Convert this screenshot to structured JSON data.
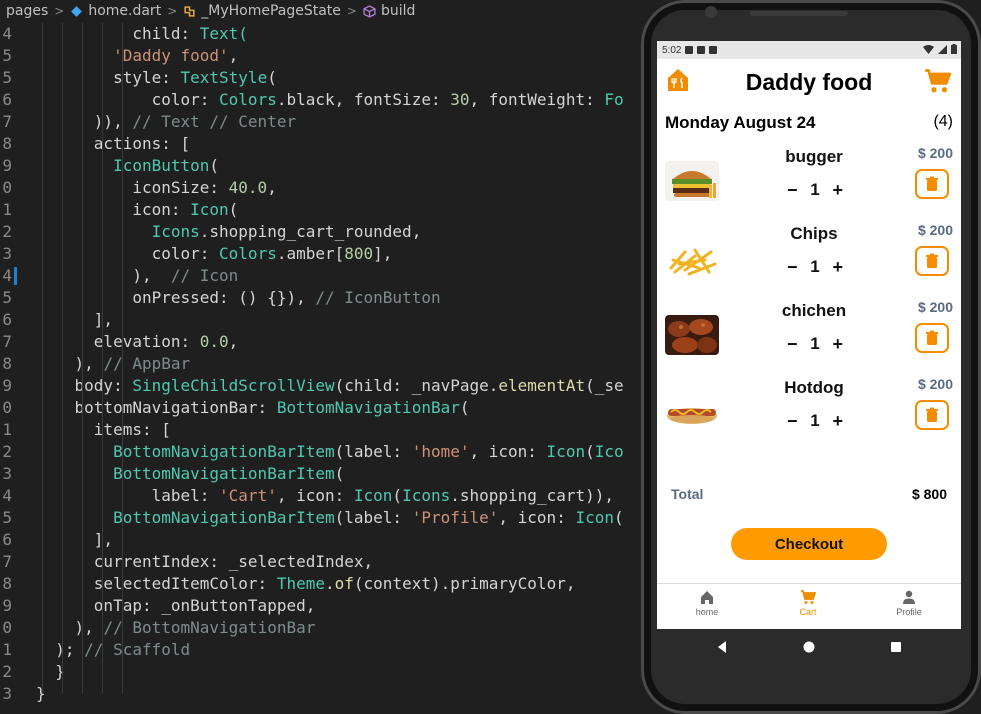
{
  "editor": {
    "breadcrumb": [
      "pages",
      "home.dart",
      "_MyHomePageState",
      "build"
    ],
    "lines": [
      {
        "n": "4",
        "parts": [
          {
            "t": "          child: ",
            "c": "t-prop"
          },
          {
            "t": "Text(",
            "c": "t-cls"
          }
        ]
      },
      {
        "n": "5",
        "parts": [
          {
            "t": "        ",
            "c": ""
          },
          {
            "t": "'Daddy food'",
            "c": "t-str"
          },
          {
            "t": ",",
            "c": ""
          }
        ]
      },
      {
        "n": "5",
        "parts": [
          {
            "t": "        style: ",
            "c": ""
          },
          {
            "t": "TextStyle",
            "c": "t-cls"
          },
          {
            "t": "(",
            "c": ""
          }
        ]
      },
      {
        "n": "6",
        "parts": [
          {
            "t": "            color: ",
            "c": ""
          },
          {
            "t": "Colors",
            "c": "t-cls"
          },
          {
            "t": ".black, fontSize: ",
            "c": ""
          },
          {
            "t": "30",
            "c": "t-num"
          },
          {
            "t": ", fontWeight: ",
            "c": ""
          },
          {
            "t": "Fo",
            "c": "t-cls"
          }
        ]
      },
      {
        "n": "7",
        "parts": [
          {
            "t": "      )), ",
            "c": ""
          },
          {
            "t": "// Text // Center",
            "c": "t-com"
          }
        ]
      },
      {
        "n": "8",
        "parts": [
          {
            "t": "      actions: [",
            "c": ""
          }
        ]
      },
      {
        "n": "9",
        "parts": [
          {
            "t": "        ",
            "c": ""
          },
          {
            "t": "IconButton",
            "c": "t-cls"
          },
          {
            "t": "(",
            "c": ""
          }
        ]
      },
      {
        "n": "0",
        "parts": [
          {
            "t": "          iconSize: ",
            "c": ""
          },
          {
            "t": "40.0",
            "c": "t-num"
          },
          {
            "t": ",",
            "c": ""
          }
        ]
      },
      {
        "n": "1",
        "parts": [
          {
            "t": "          icon: ",
            "c": ""
          },
          {
            "t": "Icon",
            "c": "t-cls"
          },
          {
            "t": "(",
            "c": ""
          }
        ]
      },
      {
        "n": "2",
        "parts": [
          {
            "t": "            ",
            "c": ""
          },
          {
            "t": "Icons",
            "c": "t-cls"
          },
          {
            "t": ".shopping_cart_rounded,",
            "c": ""
          }
        ]
      },
      {
        "n": "3",
        "parts": [
          {
            "t": "            color: ",
            "c": ""
          },
          {
            "t": "Colors",
            "c": "t-cls"
          },
          {
            "t": ".amber[",
            "c": ""
          },
          {
            "t": "800",
            "c": "t-num"
          },
          {
            "t": "],",
            "c": ""
          }
        ]
      },
      {
        "n": "4",
        "parts": [
          {
            "t": "          ),  ",
            "c": ""
          },
          {
            "t": "// Icon",
            "c": "t-com"
          }
        ]
      },
      {
        "n": "5",
        "parts": [
          {
            "t": "          onPressed: () {}), ",
            "c": ""
          },
          {
            "t": "// IconButton",
            "c": "t-com"
          }
        ]
      },
      {
        "n": "6",
        "parts": [
          {
            "t": "      ],",
            "c": ""
          }
        ]
      },
      {
        "n": "7",
        "parts": [
          {
            "t": "      elevation: ",
            "c": ""
          },
          {
            "t": "0.0",
            "c": "t-num"
          },
          {
            "t": ",",
            "c": ""
          }
        ]
      },
      {
        "n": "8",
        "parts": [
          {
            "t": "    ), ",
            "c": ""
          },
          {
            "t": "// AppBar",
            "c": "t-com"
          }
        ]
      },
      {
        "n": "9",
        "parts": [
          {
            "t": "    body: ",
            "c": ""
          },
          {
            "t": "SingleChildScrollView",
            "c": "t-cls"
          },
          {
            "t": "(child: _navPage.",
            "c": ""
          },
          {
            "t": "elementAt",
            "c": "t-fn"
          },
          {
            "t": "(_se",
            "c": ""
          }
        ]
      },
      {
        "n": "0",
        "parts": [
          {
            "t": "    bottomNavigationBar: ",
            "c": ""
          },
          {
            "t": "BottomNavigationBar",
            "c": "t-cls"
          },
          {
            "t": "(",
            "c": ""
          }
        ]
      },
      {
        "n": "1",
        "parts": [
          {
            "t": "      items: [",
            "c": ""
          }
        ]
      },
      {
        "n": "2",
        "parts": [
          {
            "t": "        ",
            "c": ""
          },
          {
            "t": "BottomNavigationBarItem",
            "c": "t-cls"
          },
          {
            "t": "(label: ",
            "c": ""
          },
          {
            "t": "'home'",
            "c": "t-str"
          },
          {
            "t": ", icon: ",
            "c": ""
          },
          {
            "t": "Icon",
            "c": "t-cls"
          },
          {
            "t": "(",
            "c": ""
          },
          {
            "t": "Ico",
            "c": "t-cls"
          }
        ]
      },
      {
        "n": "3",
        "parts": [
          {
            "t": "        ",
            "c": ""
          },
          {
            "t": "BottomNavigationBarItem",
            "c": "t-cls"
          },
          {
            "t": "(",
            "c": ""
          }
        ]
      },
      {
        "n": "4",
        "parts": [
          {
            "t": "            label: ",
            "c": ""
          },
          {
            "t": "'Cart'",
            "c": "t-str"
          },
          {
            "t": ", icon: ",
            "c": ""
          },
          {
            "t": "Icon",
            "c": "t-cls"
          },
          {
            "t": "(",
            "c": ""
          },
          {
            "t": "Icons",
            "c": "t-cls"
          },
          {
            "t": ".shopping_cart)),",
            "c": ""
          }
        ]
      },
      {
        "n": "5",
        "parts": [
          {
            "t": "        ",
            "c": ""
          },
          {
            "t": "BottomNavigationBarItem",
            "c": "t-cls"
          },
          {
            "t": "(label: ",
            "c": ""
          },
          {
            "t": "'Profile'",
            "c": "t-str"
          },
          {
            "t": ", icon: ",
            "c": ""
          },
          {
            "t": "Icon",
            "c": "t-cls"
          },
          {
            "t": "(",
            "c": ""
          }
        ]
      },
      {
        "n": "6",
        "parts": [
          {
            "t": "      ],",
            "c": ""
          }
        ]
      },
      {
        "n": "7",
        "parts": [
          {
            "t": "      currentIndex: _selectedIndex,",
            "c": ""
          }
        ]
      },
      {
        "n": "8",
        "parts": [
          {
            "t": "      selectedItemColor: ",
            "c": ""
          },
          {
            "t": "Theme",
            "c": "t-cls"
          },
          {
            "t": ".",
            "c": ""
          },
          {
            "t": "of",
            "c": "t-fn"
          },
          {
            "t": "(context).primaryColor,",
            "c": ""
          }
        ]
      },
      {
        "n": "9",
        "parts": [
          {
            "t": "      onTap: _onButtonTapped,",
            "c": ""
          }
        ]
      },
      {
        "n": "0",
        "parts": [
          {
            "t": "    ), ",
            "c": ""
          },
          {
            "t": "// BottomNavigationBar",
            "c": "t-com"
          }
        ]
      },
      {
        "n": "1",
        "parts": [
          {
            "t": "  ); ",
            "c": ""
          },
          {
            "t": "// Scaffold",
            "c": "t-com"
          }
        ]
      },
      {
        "n": "2",
        "parts": [
          {
            "t": "  }",
            "c": ""
          }
        ]
      },
      {
        "n": "3",
        "parts": [
          {
            "t": "}",
            "c": ""
          }
        ]
      }
    ]
  },
  "app": {
    "status_time": "5:02",
    "title": "Daddy food",
    "date": "Monday August 24",
    "count": "(4)",
    "items": [
      {
        "name": "bugger",
        "qty": "1",
        "price": "$ 200",
        "img": "burger"
      },
      {
        "name": "Chips",
        "qty": "1",
        "price": "$ 200",
        "img": "fries"
      },
      {
        "name": "chichen",
        "qty": "1",
        "price": "$ 200",
        "img": "chicken"
      },
      {
        "name": "Hotdog",
        "qty": "1",
        "price": "$ 200",
        "img": "hotdog"
      }
    ],
    "minus": "−",
    "plus": "+",
    "total_label": "Total",
    "total_value": "$ 800",
    "checkout_label": "Checkout",
    "nav": [
      {
        "label": "home",
        "icon": "home-icon",
        "active": false
      },
      {
        "label": "Cart",
        "icon": "cart-icon",
        "active": true
      },
      {
        "label": "Profile",
        "icon": "person-icon",
        "active": false
      }
    ],
    "colors": {
      "accent": "#ff9b00",
      "delete": "#f58c00",
      "price": "#5a6b80"
    }
  }
}
